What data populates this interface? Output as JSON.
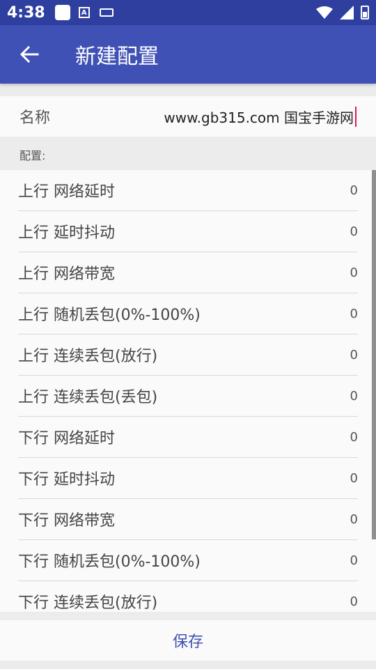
{
  "status_bar": {
    "time": "4:38",
    "icons": [
      "notification-icon",
      "font-icon",
      "keyboard-icon",
      "wifi-icon",
      "signal-icon",
      "battery-icon"
    ]
  },
  "app_bar": {
    "title": "新建配置",
    "back_icon": "arrow-left-icon",
    "color": "#3f51b5"
  },
  "name_field": {
    "label": "名称",
    "value": "www.gb315.com 国宝手游网"
  },
  "config_section": {
    "label": "配置:"
  },
  "items": [
    {
      "label": "上行 网络延时",
      "value": "0"
    },
    {
      "label": "上行 延时抖动",
      "value": "0"
    },
    {
      "label": "上行 网络带宽",
      "value": "0"
    },
    {
      "label": "上行 随机丢包(0%-100%)",
      "value": "0"
    },
    {
      "label": "上行 连续丢包(放行)",
      "value": "0"
    },
    {
      "label": "上行 连续丢包(丢包)",
      "value": "0"
    },
    {
      "label": "下行 网络延时",
      "value": "0"
    },
    {
      "label": "下行 延时抖动",
      "value": "0"
    },
    {
      "label": "下行 网络带宽",
      "value": "0"
    },
    {
      "label": "下行 随机丢包(0%-100%)",
      "value": "0"
    },
    {
      "label": "下行 连续丢包(放行)",
      "value": "0"
    }
  ],
  "save_button": {
    "label": "保存"
  }
}
